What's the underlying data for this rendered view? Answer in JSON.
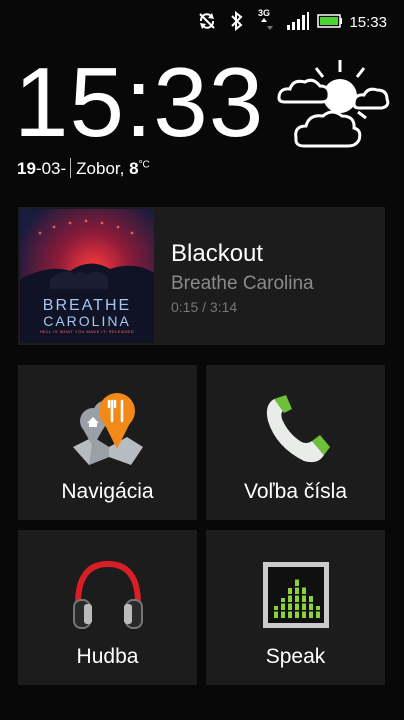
{
  "status_bar": {
    "icons": [
      "sync-off-icon",
      "bluetooth-icon",
      "3g-data-icon",
      "signal-icon",
      "battery-icon"
    ],
    "network": "3G",
    "time": "15:33",
    "battery_color": "#4cd137"
  },
  "clock_widget": {
    "time": "15:33",
    "date_day": "19",
    "date_rest": "-03-",
    "location": "Zobor,",
    "temperature": "8",
    "temperature_unit": "°C",
    "weather_icon": "partly-cloudy-icon"
  },
  "music": {
    "title": "Blackout",
    "artist": "Breathe Carolina",
    "progress": "0:15 / 3:14",
    "album_line1": "BREATHE",
    "album_line2": "CAROLINA",
    "album_tagline": "HELL IS WHAT YOU MAKE IT: RELEASED"
  },
  "tiles": [
    {
      "label": "Navigácia",
      "icon": "navigation-map-icon"
    },
    {
      "label": "Voľba čísla",
      "icon": "phone-icon"
    },
    {
      "label": "Hudba",
      "icon": "headphones-icon"
    },
    {
      "label": "Speak",
      "icon": "equalizer-icon"
    }
  ],
  "colors": {
    "accent_green": "#7ac943",
    "tile_background": "#1c1c1c",
    "artist_text": "#8a8a8a"
  }
}
